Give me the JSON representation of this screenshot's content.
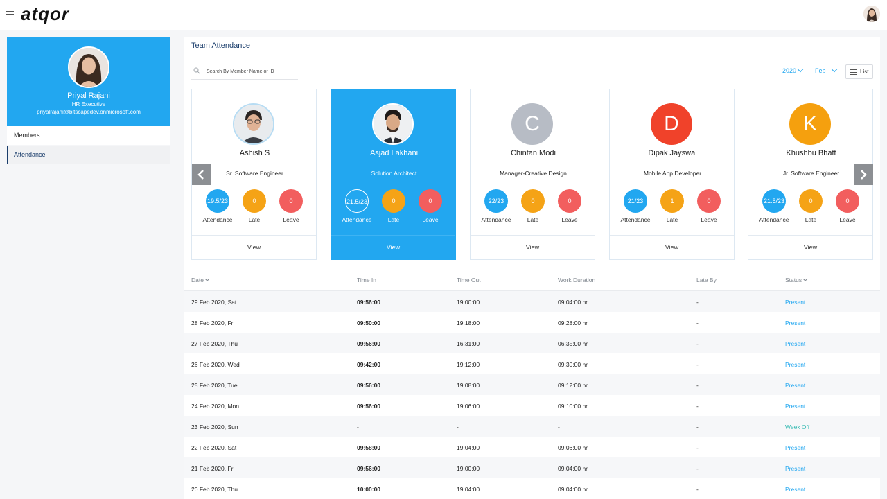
{
  "app": {
    "logo": "atqor"
  },
  "profile": {
    "name": "Priyal Rajani",
    "role": "HR Executive",
    "email": "priyalrajani@bitscapedev.onmicrosoft.com"
  },
  "nav": {
    "members": "Members",
    "attendance": "Attendance"
  },
  "page": {
    "title": "Team Attendance"
  },
  "search": {
    "placeholder": "Search By Member Name or ID"
  },
  "filters": {
    "year": "2020",
    "month": "Feb",
    "list_label": "List"
  },
  "colors": {
    "accent": "#22a7f0",
    "late": "#f5a316",
    "leave": "#f25e5e",
    "nav_active": "#1a3d6b"
  },
  "stat_labels": {
    "attendance": "Attendance",
    "late": "Late",
    "leave": "Leave",
    "view": "View"
  },
  "members": [
    {
      "name": "Ashish S",
      "title": "Sr. Software Engineer",
      "attendance": "19.5/23",
      "late": "0",
      "leave": "0",
      "avatar": "photo"
    },
    {
      "name": "Asjad Lakhani",
      "title": "Solution Architect",
      "attendance": "21.5/23",
      "late": "0",
      "leave": "0",
      "avatar": "photo",
      "selected": true
    },
    {
      "name": "Chintan Modi",
      "title": "Manager-Creative Design",
      "attendance": "22/23",
      "late": "0",
      "leave": "0",
      "initial": "C",
      "initial_color": "#b7bcc5"
    },
    {
      "name": "Dipak Jayswal",
      "title": "Mobile App Developer",
      "attendance": "21/23",
      "late": "1",
      "leave": "0",
      "initial": "D",
      "initial_color": "#f0422a"
    },
    {
      "name": "Khushbu Bhatt",
      "title": "Jr. Software Engineer",
      "attendance": "21.5/23",
      "late": "0",
      "leave": "0",
      "initial": "K",
      "initial_color": "#f5a00e"
    }
  ],
  "table": {
    "headers": {
      "date": "Date",
      "time_in": "Time In",
      "time_out": "Time Out",
      "work_duration": "Work Duration",
      "late_by": "Late By",
      "status": "Status"
    },
    "rows": [
      {
        "date": "29 Feb 2020, Sat",
        "time_in": "09:56:00",
        "time_out": "19:00:00",
        "duration": "09:04:00 hr",
        "late_by": "-",
        "status": "Present"
      },
      {
        "date": "28 Feb 2020, Fri",
        "time_in": "09:50:00",
        "time_out": "19:18:00",
        "duration": "09:28:00 hr",
        "late_by": "-",
        "status": "Present"
      },
      {
        "date": "27 Feb 2020, Thu",
        "time_in": "09:56:00",
        "time_out": "16:31:00",
        "duration": "06:35:00 hr",
        "late_by": "-",
        "status": "Present"
      },
      {
        "date": "26 Feb 2020, Wed",
        "time_in": "09:42:00",
        "time_out": "19:12:00",
        "duration": "09:30:00 hr",
        "late_by": "-",
        "status": "Present"
      },
      {
        "date": "25 Feb 2020, Tue",
        "time_in": "09:56:00",
        "time_out": "19:08:00",
        "duration": "09:12:00 hr",
        "late_by": "-",
        "status": "Present"
      },
      {
        "date": "24 Feb 2020, Mon",
        "time_in": "09:56:00",
        "time_out": "19:06:00",
        "duration": "09:10:00 hr",
        "late_by": "-",
        "status": "Present"
      },
      {
        "date": "23 Feb 2020, Sun",
        "time_in": "-",
        "time_out": "-",
        "duration": "-",
        "late_by": "-",
        "status": "Week Off"
      },
      {
        "date": "22 Feb 2020, Sat",
        "time_in": "09:58:00",
        "time_out": "19:04:00",
        "duration": "09:06:00 hr",
        "late_by": "-",
        "status": "Present"
      },
      {
        "date": "21 Feb 2020, Fri",
        "time_in": "09:56:00",
        "time_out": "19:00:00",
        "duration": "09:04:00 hr",
        "late_by": "-",
        "status": "Present"
      },
      {
        "date": "20 Feb 2020, Thu",
        "time_in": "10:00:00",
        "time_out": "19:04:00",
        "duration": "09:04:00 hr",
        "late_by": "-",
        "status": "Present"
      }
    ]
  }
}
